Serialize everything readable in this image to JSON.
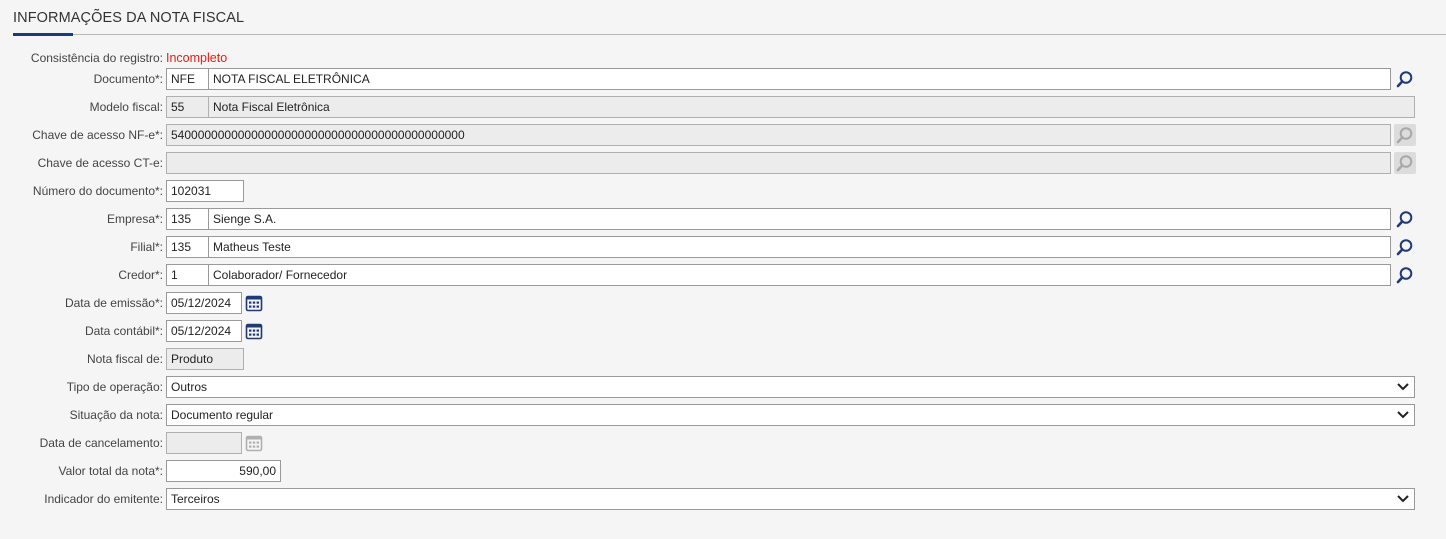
{
  "section": {
    "title": "INFORMAÇÕES DA NOTA FISCAL"
  },
  "consistencia": {
    "label": "Consistência do registro:",
    "value": "Incompleto"
  },
  "documento": {
    "label": "Documento*:",
    "code": "NFE",
    "desc": "NOTA FISCAL ELETRÔNICA"
  },
  "modelo": {
    "label": "Modelo fiscal:",
    "code": "55",
    "desc": "Nota Fiscal Eletrônica"
  },
  "chave_nfe": {
    "label": "Chave de acesso NF-e*:",
    "value": "54000000000000000000000000000000000000000000"
  },
  "chave_cte": {
    "label": "Chave de acesso CT-e:",
    "value": ""
  },
  "numero": {
    "label": "Número do documento*:",
    "value": "102031"
  },
  "empresa": {
    "label": "Empresa*:",
    "code": "135",
    "desc": "Sienge S.A."
  },
  "filial": {
    "label": "Filial*:",
    "code": "135",
    "desc": "Matheus Teste"
  },
  "credor": {
    "label": "Credor*:",
    "code": "1",
    "desc": "Colaborador/ Fornecedor"
  },
  "emissao": {
    "label": "Data de emissão*:",
    "value": "05/12/2024"
  },
  "contabil": {
    "label": "Data contábil*:",
    "value": "05/12/2024"
  },
  "nota_de": {
    "label": "Nota fiscal de:",
    "value": "Produto"
  },
  "tipo_operacao": {
    "label": "Tipo de operação:",
    "value": "Outros"
  },
  "situacao": {
    "label": "Situação da nota:",
    "value": "Documento regular"
  },
  "cancelamento": {
    "label": "Data de cancelamento:",
    "value": ""
  },
  "valor_total": {
    "label": "Valor total da nota*:",
    "value": "590,00"
  },
  "indicador": {
    "label": "Indicador do emitente:",
    "value": "Terceiros"
  },
  "colors": {
    "accent": "#1f3a7a",
    "status_red": "#e02020",
    "icon_blue": "#1f3a7a",
    "disabled_icon": "#a8a8a8"
  },
  "icons": {
    "lookup": "search-icon",
    "calendar": "calendar-icon",
    "dropdown": "chevron-down-icon"
  }
}
